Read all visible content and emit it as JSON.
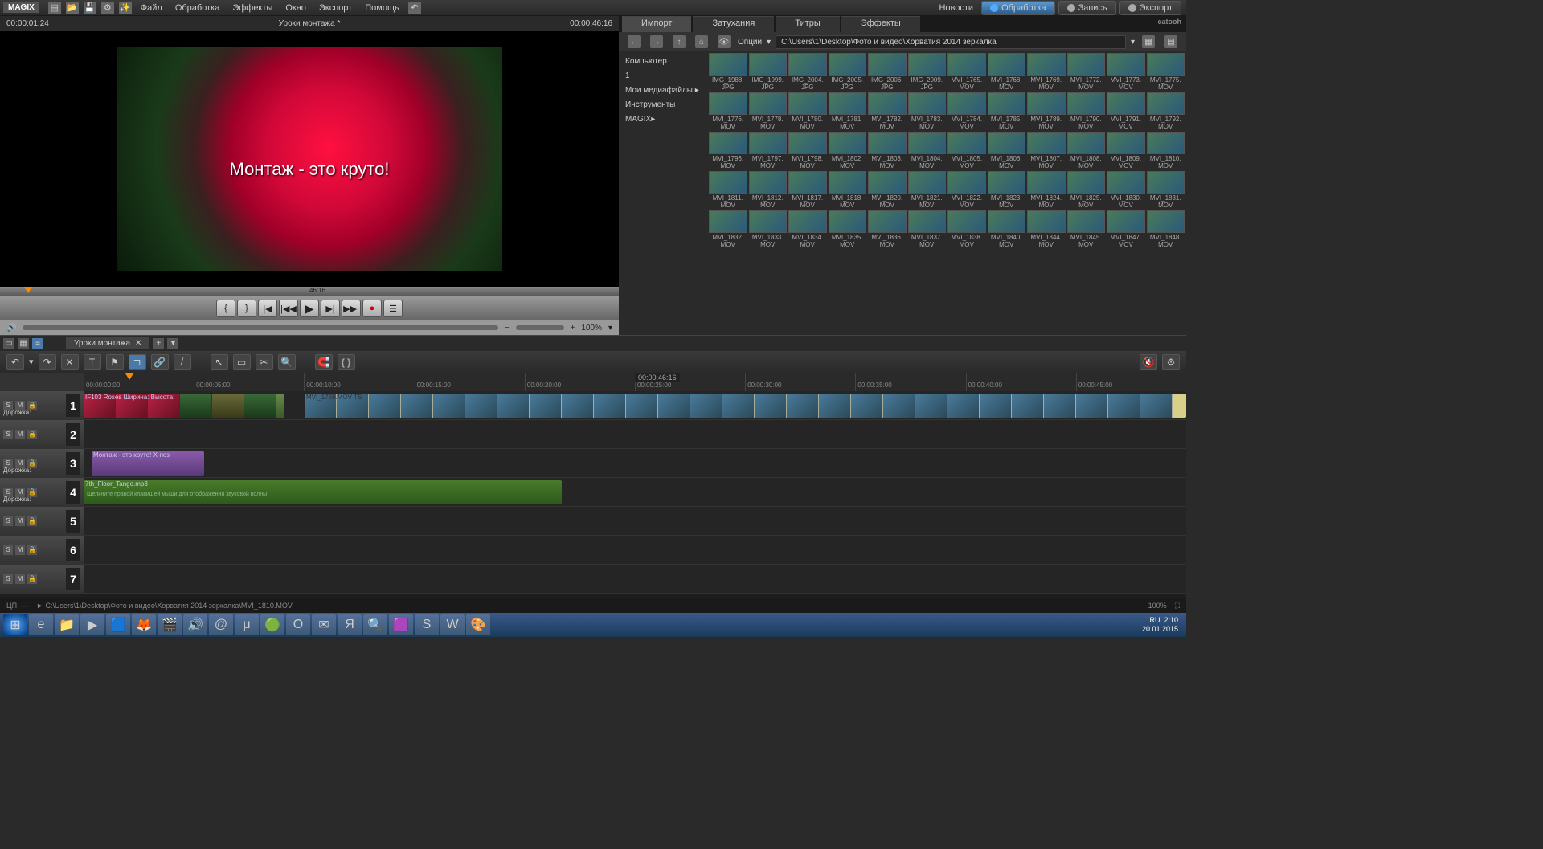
{
  "app": {
    "logo": "MAGIX"
  },
  "menu": [
    "Файл",
    "Обработка",
    "Эффекты",
    "Окно",
    "Экспорт",
    "Помощь"
  ],
  "top_right": {
    "news": "Новости",
    "edit": "Обработка",
    "record": "Запись",
    "export": "Экспорт"
  },
  "preview": {
    "timecode_left": "00:00:01:24",
    "title": "Уроки монтажа *",
    "timecode_right": "00:00:46:16",
    "overlay": "Монтаж - это круто!",
    "scrub_label": "46:16",
    "zoom_pct": "100%"
  },
  "media": {
    "tabs": [
      "Импорт",
      "Затухания",
      "Титры",
      "Эффекты"
    ],
    "options": "Опции",
    "path": "C:\\Users\\1\\Desktop\\Фото и видео\\Хорватия 2014 зеркалка",
    "tree": {
      "computer": "Компьютер",
      "one": "1",
      "myfiles": "Мои медиафайлы",
      "tools": "Инструменты MAGIX"
    },
    "files": [
      {
        "n": "IMG_1988.",
        "e": "JPG"
      },
      {
        "n": "IMG_1999.",
        "e": "JPG"
      },
      {
        "n": "IMG_2004.",
        "e": "JPG"
      },
      {
        "n": "IMG_2005.",
        "e": "JPG"
      },
      {
        "n": "IMG_2006.",
        "e": "JPG"
      },
      {
        "n": "IMG_2009.",
        "e": "JPG"
      },
      {
        "n": "MVI_1765.",
        "e": "MOV"
      },
      {
        "n": "MVI_1768.",
        "e": "MOV"
      },
      {
        "n": "MVI_1769.",
        "e": "MOV"
      },
      {
        "n": "MVI_1772.",
        "e": "MOV"
      },
      {
        "n": "MVI_1773.",
        "e": "MOV"
      },
      {
        "n": "MVI_1775.",
        "e": "MOV"
      },
      {
        "n": "MVI_1776.",
        "e": "MOV"
      },
      {
        "n": "MVI_1778.",
        "e": "MOV"
      },
      {
        "n": "MVI_1780.",
        "e": "MOV"
      },
      {
        "n": "MVI_1781.",
        "e": "MOV"
      },
      {
        "n": "MVI_1782.",
        "e": "MOV"
      },
      {
        "n": "MVI_1783.",
        "e": "MOV"
      },
      {
        "n": "MVI_1784.",
        "e": "MOV"
      },
      {
        "n": "MVI_1785.",
        "e": "MOV"
      },
      {
        "n": "MVI_1789.",
        "e": "MOV"
      },
      {
        "n": "MVI_1790.",
        "e": "MOV"
      },
      {
        "n": "MVI_1791.",
        "e": "MOV"
      },
      {
        "n": "MVI_1792.",
        "e": "MOV"
      },
      {
        "n": "MVI_1796.",
        "e": "MOV"
      },
      {
        "n": "MVI_1797.",
        "e": "MOV"
      },
      {
        "n": "MVI_1798.",
        "e": "MOV"
      },
      {
        "n": "MVI_1802.",
        "e": "MOV"
      },
      {
        "n": "MVI_1803.",
        "e": "MOV"
      },
      {
        "n": "MVI_1804.",
        "e": "MOV"
      },
      {
        "n": "MVI_1805.",
        "e": "MOV"
      },
      {
        "n": "MVI_1806.",
        "e": "MOV"
      },
      {
        "n": "MVI_1807.",
        "e": "MOV"
      },
      {
        "n": "MVI_1808.",
        "e": "MOV"
      },
      {
        "n": "MVI_1809.",
        "e": "MOV"
      },
      {
        "n": "MVI_1810.",
        "e": "MOV"
      },
      {
        "n": "MVI_1811.",
        "e": "MOV"
      },
      {
        "n": "MVI_1812.",
        "e": "MOV"
      },
      {
        "n": "MVI_1817.",
        "e": "MOV"
      },
      {
        "n": "MVI_1818.",
        "e": "MOV"
      },
      {
        "n": "MVI_1820.",
        "e": "MOV"
      },
      {
        "n": "MVI_1821.",
        "e": "MOV"
      },
      {
        "n": "MVI_1822.",
        "e": "MOV"
      },
      {
        "n": "MVI_1823.",
        "e": "MOV"
      },
      {
        "n": "MVI_1824.",
        "e": "MOV"
      },
      {
        "n": "MVI_1825.",
        "e": "MOV"
      },
      {
        "n": "MVI_1830.",
        "e": "MOV"
      },
      {
        "n": "MVI_1831.",
        "e": "MOV"
      },
      {
        "n": "MVI_1832.",
        "e": "MOV"
      },
      {
        "n": "MVI_1833.",
        "e": "MOV"
      },
      {
        "n": "MVI_1834.",
        "e": "MOV"
      },
      {
        "n": "MVI_1835.",
        "e": "MOV"
      },
      {
        "n": "MVI_1836.",
        "e": "MOV"
      },
      {
        "n": "MVI_1837.",
        "e": "MOV"
      },
      {
        "n": "MVI_1838.",
        "e": "MOV"
      },
      {
        "n": "MVI_1840.",
        "e": "MOV"
      },
      {
        "n": "MVI_1844.",
        "e": "MOV"
      },
      {
        "n": "MVI_1845.",
        "e": "MOV"
      },
      {
        "n": "MVI_1847.",
        "e": "MOV"
      },
      {
        "n": "MVI_1848.",
        "e": "MOV"
      }
    ]
  },
  "project_tab": "Уроки монтажа",
  "timeline": {
    "duration": "00:00:46:16",
    "ticks": [
      "00:00:00:00",
      "00:00:05:00",
      "00:00:10:00",
      "00:00:15:00",
      "00:00:20:00",
      "00:00:25:00",
      "00:00:30:00",
      "00:00:35:00",
      "00:00:40:00",
      "00:00:45:00"
    ],
    "tracks": [
      {
        "num": "1",
        "label": "Дорожка:"
      },
      {
        "num": "2",
        "label": ""
      },
      {
        "num": "3",
        "label": "Дорожка:"
      },
      {
        "num": "4",
        "label": "Дорожка:"
      },
      {
        "num": "5",
        "label": ""
      },
      {
        "num": "6",
        "label": ""
      },
      {
        "num": "7",
        "label": ""
      }
    ],
    "clip1_label": "IF103 Roses Ширина: Высота:",
    "clip2_label": "MVI_1769.MOV TS",
    "clip3_label": "Монтаж - это круто!  X-поз",
    "clip4_label": "7th_Floor_Tango.mp3",
    "clip4_hint": "Щелкните правой клавишей мыши для отображения звуковой волны"
  },
  "status": {
    "cp": "ЦП: —",
    "path": "► C:\\Users\\1\\Desktop\\Фото и видео\\Хорватия 2014 зеркалка\\MVI_1810.MOV",
    "zoom": "100%"
  },
  "taskbar": {
    "lang": "RU",
    "time": "2:10",
    "date": "20.01.2015"
  }
}
